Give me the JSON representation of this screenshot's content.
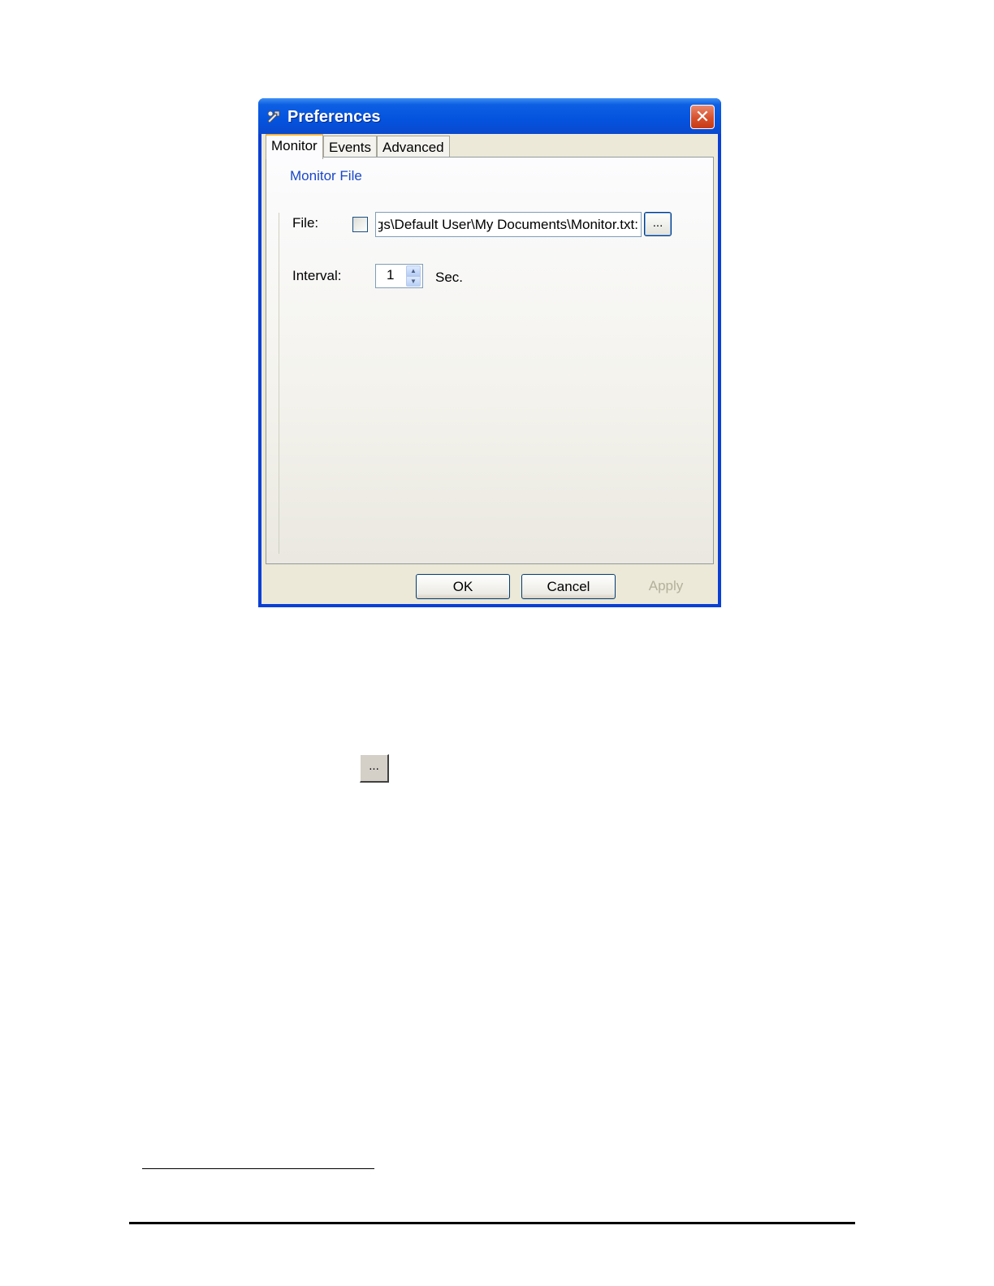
{
  "dialog": {
    "title": "Preferences",
    "close_label": "✕",
    "tabs": [
      {
        "label": "Monitor",
        "active": true
      },
      {
        "label": "Events",
        "active": false
      },
      {
        "label": "Advanced",
        "active": false
      }
    ],
    "monitor": {
      "group_title": "Monitor File",
      "file_label": "File:",
      "file_checked": false,
      "file_path": ":ings\\Default User\\My Documents\\Monitor.txt",
      "browse_label": "...",
      "interval_label": "Interval:",
      "interval_value": "1",
      "interval_unit": "Sec."
    },
    "buttons": {
      "ok": "OK",
      "cancel": "Cancel",
      "apply": "Apply"
    }
  },
  "document": {
    "browse_button_label": "..."
  },
  "colors": {
    "titlebar": "#0453de",
    "group_title": "#1a47c8",
    "client_bg": "#ece9d8",
    "close_button": "#d7512d"
  }
}
